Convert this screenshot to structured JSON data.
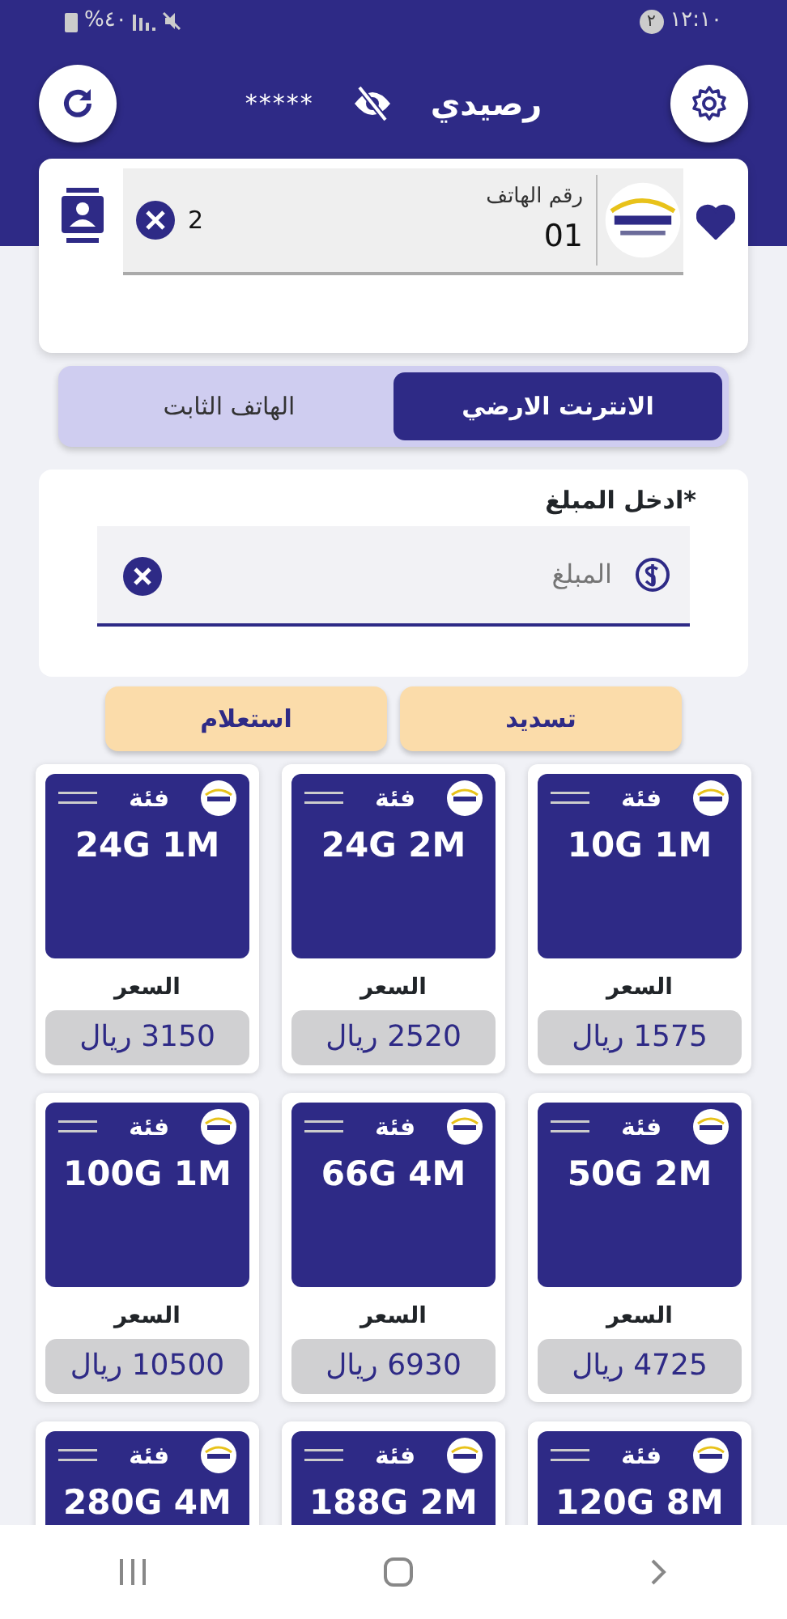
{
  "status_bar": {
    "time": "١٢:١٠",
    "notification_count": "٢",
    "battery": "%٤٠"
  },
  "header": {
    "title": "رصيدي",
    "balance": "*****",
    "balance_hidden": true
  },
  "phone_card": {
    "label": "رقم الهاتف",
    "value": "01",
    "count": "2",
    "favorite": true
  },
  "tabs": [
    {
      "label": "الانترنت الارضي",
      "selected": true
    },
    {
      "label": "الهاتف الثابت",
      "selected": false
    }
  ],
  "amount": {
    "label": "*ادخل المبلغ",
    "placeholder": "المبلغ"
  },
  "actions": [
    "تسديد",
    "استعلام"
  ],
  "packages": [
    {
      "badge": "فئة",
      "name": "10G 1M",
      "price_label": "السعر",
      "price": "1575 ريال"
    },
    {
      "badge": "فئة",
      "name": "24G 2M",
      "price_label": "السعر",
      "price": "2520 ريال"
    },
    {
      "badge": "فئة",
      "name": "24G 1M",
      "price_label": "السعر",
      "price": "3150 ريال"
    },
    {
      "badge": "فئة",
      "name": "50G 2M",
      "price_label": "السعر",
      "price": "4725 ريال"
    },
    {
      "badge": "فئة",
      "name": "66G 4M",
      "price_label": "السعر",
      "price": "6930 ريال"
    },
    {
      "badge": "فئة",
      "name": "100G 1M",
      "price_label": "السعر",
      "price": "10500 ريال"
    },
    {
      "badge": "فئة",
      "name": "120G 8M"
    },
    {
      "badge": "فئة",
      "name": "188G 2M"
    },
    {
      "badge": "فئة",
      "name": "280G 4M"
    }
  ]
}
